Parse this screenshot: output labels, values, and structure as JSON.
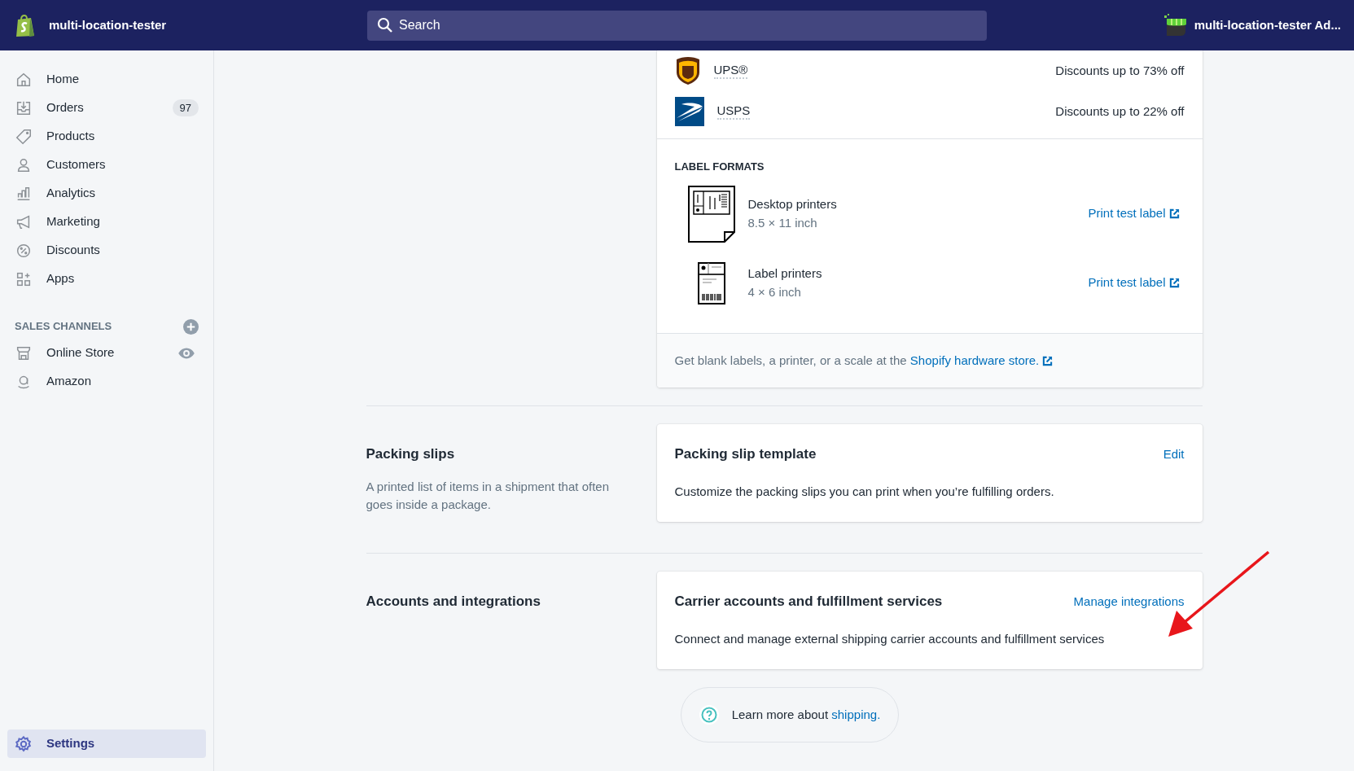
{
  "topbar": {
    "store_name": "multi-location-tester",
    "search": {
      "placeholder": "Search"
    },
    "account_name": "multi-location-tester Ad..."
  },
  "sidebar": {
    "items": [
      {
        "label": "Home",
        "selected": false
      },
      {
        "label": "Orders",
        "badge": "97",
        "selected": false
      },
      {
        "label": "Products",
        "selected": false
      },
      {
        "label": "Customers",
        "selected": false
      },
      {
        "label": "Analytics",
        "selected": false
      },
      {
        "label": "Marketing",
        "selected": false
      },
      {
        "label": "Discounts",
        "selected": false
      },
      {
        "label": "Apps",
        "selected": false
      }
    ],
    "sales_channels": {
      "heading": "SALES CHANNELS",
      "items": [
        {
          "label": "Online Store",
          "selected": false
        },
        {
          "label": "Amazon",
          "selected": false
        }
      ]
    },
    "settings": {
      "label": "Settings",
      "selected": true
    }
  },
  "carriers": [
    {
      "name": "UPS®",
      "discount": "Discounts up to 73% off"
    },
    {
      "name": "USPS",
      "discount": "Discounts up to 22% off"
    }
  ],
  "label_formats": {
    "heading": "LABEL FORMATS",
    "items": [
      {
        "title": "Desktop printers",
        "size": "8.5 × 11 inch",
        "link": "Print test label"
      },
      {
        "title": "Label printers",
        "size": "4 × 6 inch",
        "link": "Print test label"
      }
    ]
  },
  "hardware_note": {
    "text": "Get blank labels, a printer, or a scale at the ",
    "link": "Shopify hardware store."
  },
  "sections": [
    {
      "title": "Packing slips",
      "description": "A printed list of items in a shipment that often goes inside a package.",
      "card_title": "Packing slip template",
      "action": "Edit",
      "card_text": "Customize the packing slips you can print when you’re fulfilling orders."
    },
    {
      "title": "Accounts and integrations",
      "card_title": "Carrier accounts and fulfillment services",
      "action": "Manage integrations",
      "card_text": "Connect and manage external shipping carrier accounts and fulfillment services"
    }
  ],
  "learn_more": {
    "text": "Learn more about ",
    "link": "shipping."
  }
}
